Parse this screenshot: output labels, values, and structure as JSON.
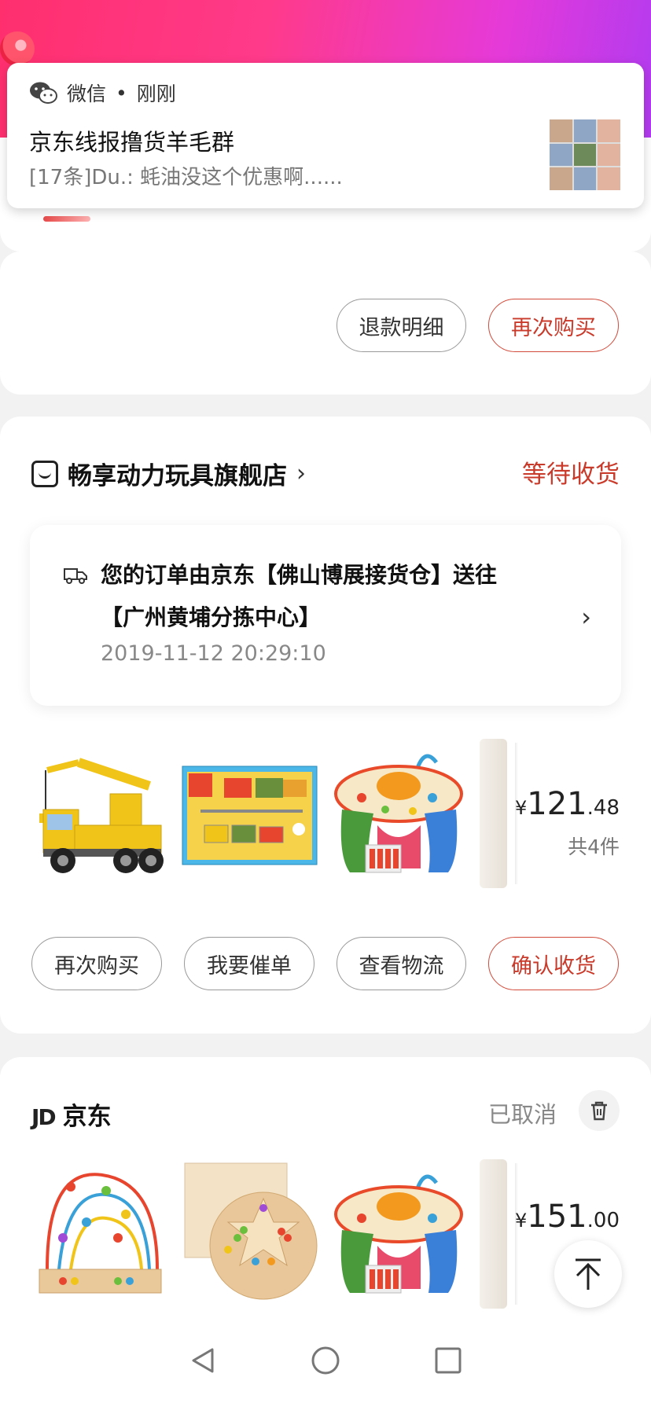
{
  "notification": {
    "app_name": "微信",
    "time": "刚刚",
    "title": "京东线报撸货羊毛群",
    "body": "[17条]Du.: 蚝油没这个优惠啊......"
  },
  "order_top": {
    "buttons": [
      "退款明细",
      "再次购买"
    ]
  },
  "order_1": {
    "store_name": "畅享动力玩具旗舰店",
    "chevron": "›",
    "status": "等待收货",
    "logistics": {
      "line1": "您的订单由京东【佛山博展接货仓】送往",
      "line2": "【广州黄埔分拣中心】",
      "time": "2019-11-12 20:29:10"
    },
    "products": [
      "crane-truck-toy",
      "construction-vehicle-set",
      "activity-table-toy"
    ],
    "price_symbol": "¥",
    "price_int": "121",
    "price_dec": ".48",
    "count": "共4件",
    "buttons": [
      "再次购买",
      "我要催单",
      "查看物流",
      "确认收货"
    ]
  },
  "order_2": {
    "logo": "JD",
    "store_name": "京东",
    "status": "已取消",
    "products": [
      "bead-maze-toy",
      "chinese-checkers-board",
      "activity-table-toy"
    ],
    "price_symbol": "¥",
    "price_int": "151",
    "price_dec": ".00"
  },
  "colors": {
    "accent_red": "#c93a2a",
    "header_start": "#ff2f6e",
    "header_end": "#b23bf0"
  }
}
